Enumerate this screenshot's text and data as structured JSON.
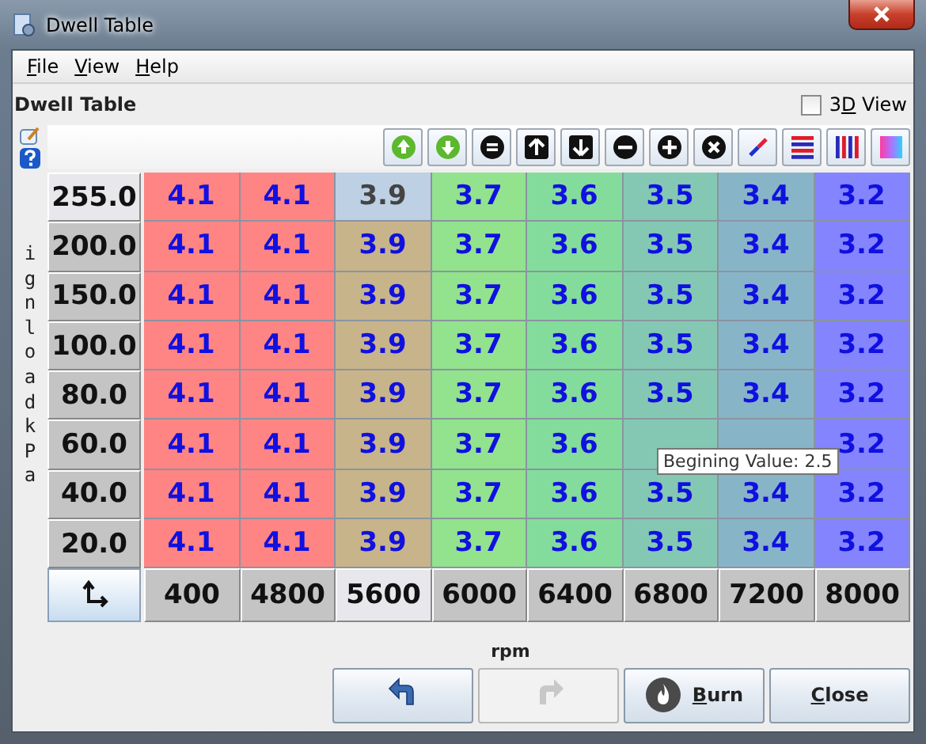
{
  "window": {
    "title": "Dwell Table"
  },
  "menu": [
    {
      "label": "File"
    },
    {
      "label": "View"
    },
    {
      "label": "Help"
    }
  ],
  "panel_title": "Dwell Table",
  "view_3d": {
    "label": "3D View",
    "checked": false
  },
  "y_axis_label": "ignload kPa",
  "x_axis_label": "rpm",
  "columns": [
    {
      "label": "400",
      "selected": false,
      "color": "#ff8585"
    },
    {
      "label": "4800",
      "selected": false,
      "color": "#ff8585"
    },
    {
      "label": "5600",
      "selected": true,
      "color": "#c8b48a"
    },
    {
      "label": "6000",
      "selected": false,
      "color": "#92e28e"
    },
    {
      "label": "6400",
      "selected": false,
      "color": "#84dc9c"
    },
    {
      "label": "6800",
      "selected": false,
      "color": "#84c8b4"
    },
    {
      "label": "7200",
      "selected": false,
      "color": "#88b4c8"
    },
    {
      "label": "8000",
      "selected": false,
      "color": "#8484ff"
    }
  ],
  "rows": [
    {
      "label": "255.0",
      "selected": true,
      "cells": [
        {
          "value": "4.1",
          "selected": false
        },
        {
          "value": "4.1",
          "selected": false
        },
        {
          "value": "3.9",
          "selected": true
        },
        {
          "value": "3.7",
          "selected": false
        },
        {
          "value": "3.6",
          "selected": false
        },
        {
          "value": "3.5",
          "selected": false
        },
        {
          "value": "3.4",
          "selected": false
        },
        {
          "value": "3.2",
          "selected": false
        }
      ]
    },
    {
      "label": "200.0",
      "selected": false,
      "cells": [
        {
          "value": "4.1",
          "selected": false
        },
        {
          "value": "4.1",
          "selected": false
        },
        {
          "value": "3.9",
          "selected": false
        },
        {
          "value": "3.7",
          "selected": false
        },
        {
          "value": "3.6",
          "selected": false
        },
        {
          "value": "3.5",
          "selected": false
        },
        {
          "value": "3.4",
          "selected": false
        },
        {
          "value": "3.2",
          "selected": false
        }
      ]
    },
    {
      "label": "150.0",
      "selected": false,
      "cells": [
        {
          "value": "4.1",
          "selected": false
        },
        {
          "value": "4.1",
          "selected": false
        },
        {
          "value": "3.9",
          "selected": false
        },
        {
          "value": "3.7",
          "selected": false
        },
        {
          "value": "3.6",
          "selected": false
        },
        {
          "value": "3.5",
          "selected": false
        },
        {
          "value": "3.4",
          "selected": false
        },
        {
          "value": "3.2",
          "selected": false
        }
      ]
    },
    {
      "label": "100.0",
      "selected": false,
      "cells": [
        {
          "value": "4.1",
          "selected": false
        },
        {
          "value": "4.1",
          "selected": false
        },
        {
          "value": "3.9",
          "selected": false
        },
        {
          "value": "3.7",
          "selected": false
        },
        {
          "value": "3.6",
          "selected": false
        },
        {
          "value": "3.5",
          "selected": false
        },
        {
          "value": "3.4",
          "selected": false
        },
        {
          "value": "3.2",
          "selected": false
        }
      ]
    },
    {
      "label": "80.0",
      "selected": false,
      "cells": [
        {
          "value": "4.1",
          "selected": false
        },
        {
          "value": "4.1",
          "selected": false
        },
        {
          "value": "3.9",
          "selected": false
        },
        {
          "value": "3.7",
          "selected": false
        },
        {
          "value": "3.6",
          "selected": false
        },
        {
          "value": "3.5",
          "selected": false
        },
        {
          "value": "3.4",
          "selected": false
        },
        {
          "value": "3.2",
          "selected": false
        }
      ]
    },
    {
      "label": "60.0",
      "selected": false,
      "cells": [
        {
          "value": "4.1",
          "selected": false
        },
        {
          "value": "4.1",
          "selected": false
        },
        {
          "value": "3.9",
          "selected": false
        },
        {
          "value": "3.7",
          "selected": false
        },
        {
          "value": "3.6",
          "selected": false
        },
        {
          "selected": false
        },
        {
          "selected": false
        },
        {
          "value": "3.2",
          "selected": false
        }
      ]
    },
    {
      "label": "40.0",
      "selected": false,
      "cells": [
        {
          "value": "4.1",
          "selected": false
        },
        {
          "value": "4.1",
          "selected": false
        },
        {
          "value": "3.9",
          "selected": false
        },
        {
          "value": "3.7",
          "selected": false
        },
        {
          "value": "3.6",
          "selected": false
        },
        {
          "value": "3.5",
          "selected": false
        },
        {
          "value": "3.4",
          "selected": false
        },
        {
          "value": "3.2",
          "selected": false
        }
      ]
    },
    {
      "label": "20.0",
      "selected": false,
      "cells": [
        {
          "value": "4.1",
          "selected": false
        },
        {
          "value": "4.1",
          "selected": false
        },
        {
          "value": "3.9",
          "selected": false
        },
        {
          "value": "3.7",
          "selected": false
        },
        {
          "value": "3.6",
          "selected": false
        },
        {
          "value": "3.5",
          "selected": false
        },
        {
          "value": "3.4",
          "selected": false
        },
        {
          "value": "3.2",
          "selected": false
        }
      ]
    }
  ],
  "tooltip": "Begining Value: 2.5",
  "buttons": [
    {
      "kind": "undo",
      "disabled": false
    },
    {
      "kind": "redo",
      "disabled": true
    },
    {
      "kind": "burn",
      "label": "Burn",
      "disabled": false
    },
    {
      "kind": "close",
      "label": "Close",
      "disabled": false
    }
  ]
}
